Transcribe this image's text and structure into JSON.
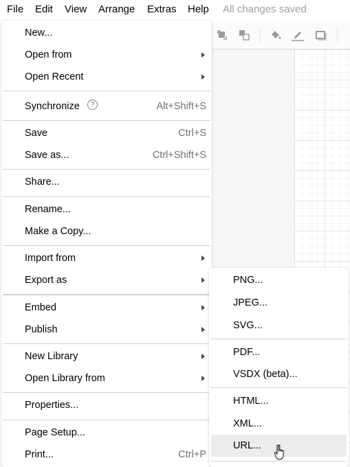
{
  "menubar": {
    "items": [
      "File",
      "Edit",
      "View",
      "Arrange",
      "Extras",
      "Help"
    ],
    "status": "All changes saved"
  },
  "toolbar": {
    "icons": [
      "to-front-icon",
      "to-back-icon",
      "fill-color-icon",
      "line-color-icon",
      "shadow-icon"
    ]
  },
  "file_menu": {
    "items": [
      {
        "label": "New...",
        "shortcut": "",
        "submenu": false
      },
      {
        "label": "Open from",
        "shortcut": "",
        "submenu": true
      },
      {
        "label": "Open Recent",
        "shortcut": "",
        "submenu": true
      },
      {
        "label": "Synchronize",
        "shortcut": "Alt+Shift+S",
        "submenu": false,
        "help_icon": "?"
      },
      {
        "label": "Save",
        "shortcut": "Ctrl+S",
        "submenu": false
      },
      {
        "label": "Save as...",
        "shortcut": "Ctrl+Shift+S",
        "submenu": false
      },
      {
        "label": "Share...",
        "shortcut": "",
        "submenu": false
      },
      {
        "label": "Rename...",
        "shortcut": "",
        "submenu": false
      },
      {
        "label": "Make a Copy...",
        "shortcut": "",
        "submenu": false
      },
      {
        "label": "Import from",
        "shortcut": "",
        "submenu": true
      },
      {
        "label": "Export as",
        "shortcut": "",
        "submenu": true
      },
      {
        "label": "Embed",
        "shortcut": "",
        "submenu": true
      },
      {
        "label": "Publish",
        "shortcut": "",
        "submenu": true
      },
      {
        "label": "New Library",
        "shortcut": "",
        "submenu": true
      },
      {
        "label": "Open Library from",
        "shortcut": "",
        "submenu": true
      },
      {
        "label": "Properties...",
        "shortcut": "",
        "submenu": false
      },
      {
        "label": "Page Setup...",
        "shortcut": "",
        "submenu": false
      },
      {
        "label": "Print...",
        "shortcut": "Ctrl+P",
        "submenu": false
      }
    ]
  },
  "export_menu": {
    "items": [
      {
        "label": "PNG..."
      },
      {
        "label": "JPEG..."
      },
      {
        "label": "SVG..."
      },
      {
        "label": "PDF..."
      },
      {
        "label": "VSDX (beta)..."
      },
      {
        "label": "HTML..."
      },
      {
        "label": "XML..."
      },
      {
        "label": "URL...",
        "hovered": true
      }
    ]
  }
}
